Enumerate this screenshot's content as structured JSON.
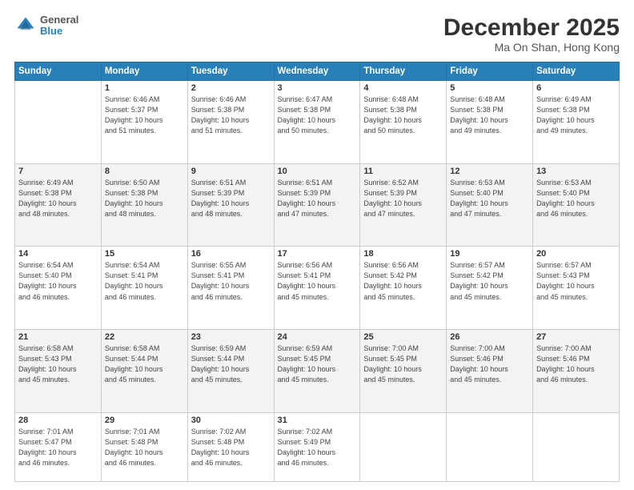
{
  "header": {
    "logo_line1": "General",
    "logo_line2": "Blue",
    "title": "December 2025",
    "subtitle": "Ma On Shan, Hong Kong"
  },
  "weekdays": [
    "Sunday",
    "Monday",
    "Tuesday",
    "Wednesday",
    "Thursday",
    "Friday",
    "Saturday"
  ],
  "rows": [
    [
      {
        "num": "",
        "detail": ""
      },
      {
        "num": "1",
        "detail": "Sunrise: 6:46 AM\nSunset: 5:37 PM\nDaylight: 10 hours\nand 51 minutes."
      },
      {
        "num": "2",
        "detail": "Sunrise: 6:46 AM\nSunset: 5:38 PM\nDaylight: 10 hours\nand 51 minutes."
      },
      {
        "num": "3",
        "detail": "Sunrise: 6:47 AM\nSunset: 5:38 PM\nDaylight: 10 hours\nand 50 minutes."
      },
      {
        "num": "4",
        "detail": "Sunrise: 6:48 AM\nSunset: 5:38 PM\nDaylight: 10 hours\nand 50 minutes."
      },
      {
        "num": "5",
        "detail": "Sunrise: 6:48 AM\nSunset: 5:38 PM\nDaylight: 10 hours\nand 49 minutes."
      },
      {
        "num": "6",
        "detail": "Sunrise: 6:49 AM\nSunset: 5:38 PM\nDaylight: 10 hours\nand 49 minutes."
      }
    ],
    [
      {
        "num": "7",
        "detail": "Sunrise: 6:49 AM\nSunset: 5:38 PM\nDaylight: 10 hours\nand 48 minutes."
      },
      {
        "num": "8",
        "detail": "Sunrise: 6:50 AM\nSunset: 5:38 PM\nDaylight: 10 hours\nand 48 minutes."
      },
      {
        "num": "9",
        "detail": "Sunrise: 6:51 AM\nSunset: 5:39 PM\nDaylight: 10 hours\nand 48 minutes."
      },
      {
        "num": "10",
        "detail": "Sunrise: 6:51 AM\nSunset: 5:39 PM\nDaylight: 10 hours\nand 47 minutes."
      },
      {
        "num": "11",
        "detail": "Sunrise: 6:52 AM\nSunset: 5:39 PM\nDaylight: 10 hours\nand 47 minutes."
      },
      {
        "num": "12",
        "detail": "Sunrise: 6:53 AM\nSunset: 5:40 PM\nDaylight: 10 hours\nand 47 minutes."
      },
      {
        "num": "13",
        "detail": "Sunrise: 6:53 AM\nSunset: 5:40 PM\nDaylight: 10 hours\nand 46 minutes."
      }
    ],
    [
      {
        "num": "14",
        "detail": "Sunrise: 6:54 AM\nSunset: 5:40 PM\nDaylight: 10 hours\nand 46 minutes."
      },
      {
        "num": "15",
        "detail": "Sunrise: 6:54 AM\nSunset: 5:41 PM\nDaylight: 10 hours\nand 46 minutes."
      },
      {
        "num": "16",
        "detail": "Sunrise: 6:55 AM\nSunset: 5:41 PM\nDaylight: 10 hours\nand 46 minutes."
      },
      {
        "num": "17",
        "detail": "Sunrise: 6:56 AM\nSunset: 5:41 PM\nDaylight: 10 hours\nand 45 minutes."
      },
      {
        "num": "18",
        "detail": "Sunrise: 6:56 AM\nSunset: 5:42 PM\nDaylight: 10 hours\nand 45 minutes."
      },
      {
        "num": "19",
        "detail": "Sunrise: 6:57 AM\nSunset: 5:42 PM\nDaylight: 10 hours\nand 45 minutes."
      },
      {
        "num": "20",
        "detail": "Sunrise: 6:57 AM\nSunset: 5:43 PM\nDaylight: 10 hours\nand 45 minutes."
      }
    ],
    [
      {
        "num": "21",
        "detail": "Sunrise: 6:58 AM\nSunset: 5:43 PM\nDaylight: 10 hours\nand 45 minutes."
      },
      {
        "num": "22",
        "detail": "Sunrise: 6:58 AM\nSunset: 5:44 PM\nDaylight: 10 hours\nand 45 minutes."
      },
      {
        "num": "23",
        "detail": "Sunrise: 6:59 AM\nSunset: 5:44 PM\nDaylight: 10 hours\nand 45 minutes."
      },
      {
        "num": "24",
        "detail": "Sunrise: 6:59 AM\nSunset: 5:45 PM\nDaylight: 10 hours\nand 45 minutes."
      },
      {
        "num": "25",
        "detail": "Sunrise: 7:00 AM\nSunset: 5:45 PM\nDaylight: 10 hours\nand 45 minutes."
      },
      {
        "num": "26",
        "detail": "Sunrise: 7:00 AM\nSunset: 5:46 PM\nDaylight: 10 hours\nand 45 minutes."
      },
      {
        "num": "27",
        "detail": "Sunrise: 7:00 AM\nSunset: 5:46 PM\nDaylight: 10 hours\nand 46 minutes."
      }
    ],
    [
      {
        "num": "28",
        "detail": "Sunrise: 7:01 AM\nSunset: 5:47 PM\nDaylight: 10 hours\nand 46 minutes."
      },
      {
        "num": "29",
        "detail": "Sunrise: 7:01 AM\nSunset: 5:48 PM\nDaylight: 10 hours\nand 46 minutes."
      },
      {
        "num": "30",
        "detail": "Sunrise: 7:02 AM\nSunset: 5:48 PM\nDaylight: 10 hours\nand 46 minutes."
      },
      {
        "num": "31",
        "detail": "Sunrise: 7:02 AM\nSunset: 5:49 PM\nDaylight: 10 hours\nand 46 minutes."
      },
      {
        "num": "",
        "detail": ""
      },
      {
        "num": "",
        "detail": ""
      },
      {
        "num": "",
        "detail": ""
      }
    ]
  ]
}
